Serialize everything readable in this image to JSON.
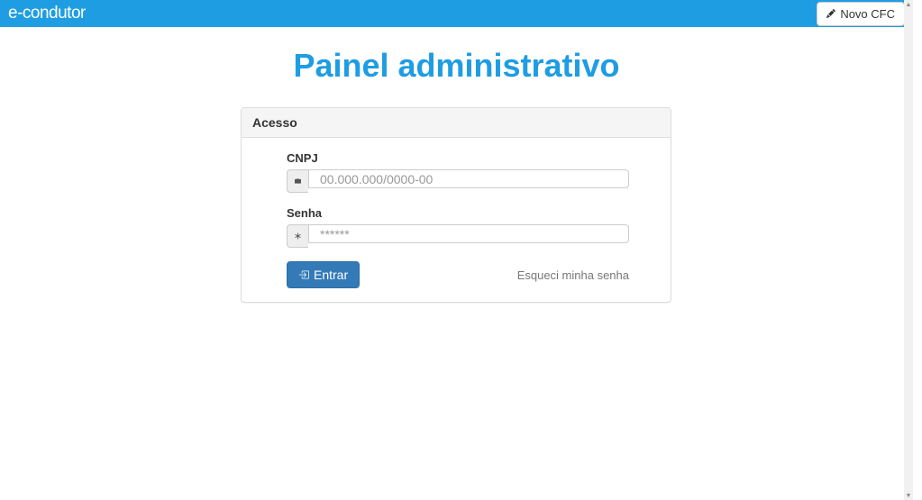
{
  "navbar": {
    "logo": "e-condutor",
    "novo_cfc_label": "Novo CFC"
  },
  "page": {
    "title": "Painel administrativo"
  },
  "panel": {
    "heading": "Acesso"
  },
  "form": {
    "cnpj": {
      "label": "CNPJ",
      "placeholder": "00.000.000/0000-00",
      "value": ""
    },
    "senha": {
      "label": "Senha",
      "placeholder": "******",
      "value": ""
    },
    "submit_label": "Entrar",
    "forgot_label": "Esqueci minha senha"
  }
}
